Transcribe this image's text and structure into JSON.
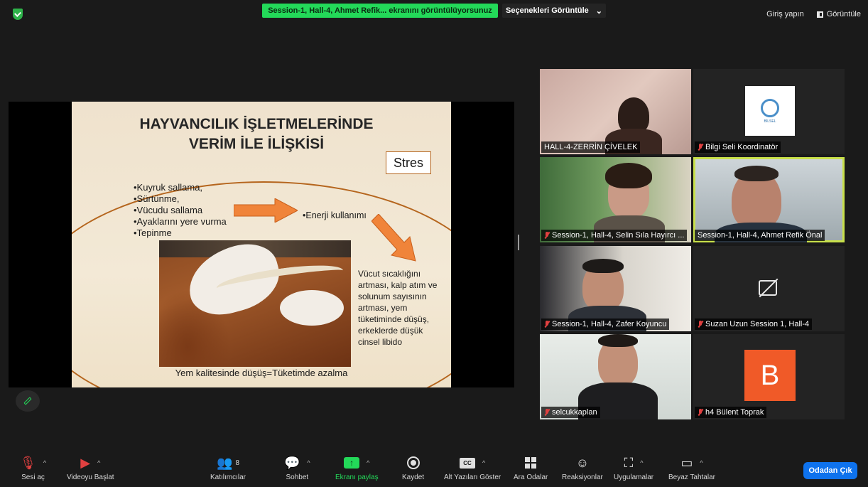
{
  "topbar": {
    "share_banner": "Session-1, Hall-4, Ahmet Refik... ekranını görüntülüyorsunuz",
    "view_options": "Seçenekleri Görüntüle",
    "sign_in": "Giriş yapın",
    "view": "Görüntüle"
  },
  "slide": {
    "title_line1": "HAYVANCILIK İŞLETMELERİNDE",
    "title_line2": "VERİM İLE İLİŞKİSİ",
    "stres": "Stres",
    "bullets": [
      "•Kuyruk sallama,",
      "•Sürtünme,",
      "•Vücudu sallama",
      "•Ayaklarını yere vurma",
      "•Tepinme"
    ],
    "energy": "•Enerji kullanımı",
    "effects": "Vücut sıcaklığını artması, kalp atım ve solunum sayısının artması, yem tüketiminde düşüş, erkeklerde düşük cinsel libido",
    "bottom": "Yem kalitesinde düşüş=Tüketimde azalma"
  },
  "participants": [
    {
      "name": "HALL-4-ZERRİN ÇİVELEK",
      "muted": false
    },
    {
      "name": "Bilgi Seli Koordinatör",
      "muted": true
    },
    {
      "name": "Session-1, Hall-4, Selin Sıla Hayırcı ...",
      "muted": true
    },
    {
      "name": "Session-1, Hall-4, Ahmet Refik Önal",
      "muted": false
    },
    {
      "name": "Session-1, Hall-4, Zafer Koyuncu",
      "muted": true
    },
    {
      "name": "Suzan Uzun Session 1, Hall-4",
      "muted": true
    },
    {
      "name": "selcukkaplan",
      "muted": true
    },
    {
      "name": "h4 Bülent Toprak",
      "muted": true
    }
  ],
  "logo_text": "BİLSEL",
  "avatar_letter": "B",
  "toolbar": {
    "unmute": "Sesi aç",
    "start_video": "Videoyu Başlat",
    "participants": "Katılımcılar",
    "participant_count": "8",
    "chat": "Sohbet",
    "share_screen": "Ekranı paylaş",
    "record": "Kaydet",
    "captions": "Alt Yazıları Göster",
    "captions_badge": "CC",
    "breakout": "Ara Odalar",
    "reactions": "Reaksiyonlar",
    "apps": "Uygulamalar",
    "whiteboard": "Beyaz Tahtalar",
    "leave": "Odadan Çık"
  },
  "colors": {
    "accent_green": "#23d959",
    "leave_blue": "#0e72ed",
    "active_speaker": "#c8e04a"
  }
}
